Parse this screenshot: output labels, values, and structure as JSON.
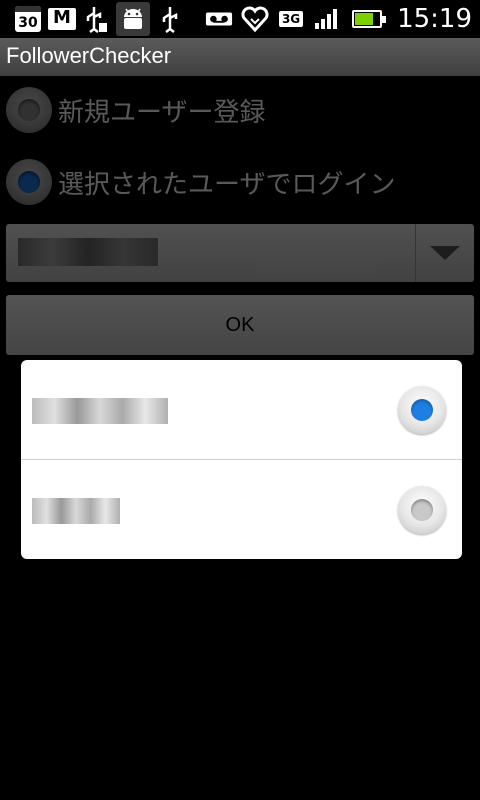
{
  "status_bar": {
    "calendar_day": "30",
    "network": "3G",
    "time": "15:19",
    "icons": [
      "calendar-icon",
      "gmail-icon",
      "usb-debug-icon",
      "android-debug-icon",
      "usb-icon",
      "voicemail-icon",
      "heart-icon",
      "network-3g-icon",
      "signal-icon",
      "battery-charging-icon"
    ],
    "battery_fill_color": "#7fd000"
  },
  "app": {
    "title": "FollowerChecker"
  },
  "login_options": {
    "new_user_label": "新規ユーザー登録",
    "existing_user_label": "選択されたユーザでログイン",
    "selected_option": "existing_user"
  },
  "account_spinner": {
    "selected_value_redacted": true
  },
  "ok_button": {
    "label": "OK"
  },
  "account_dialog": {
    "items": [
      {
        "redacted": true,
        "selected": true
      },
      {
        "redacted": true,
        "selected": false
      }
    ],
    "accent_color": "#1e7fe3"
  }
}
